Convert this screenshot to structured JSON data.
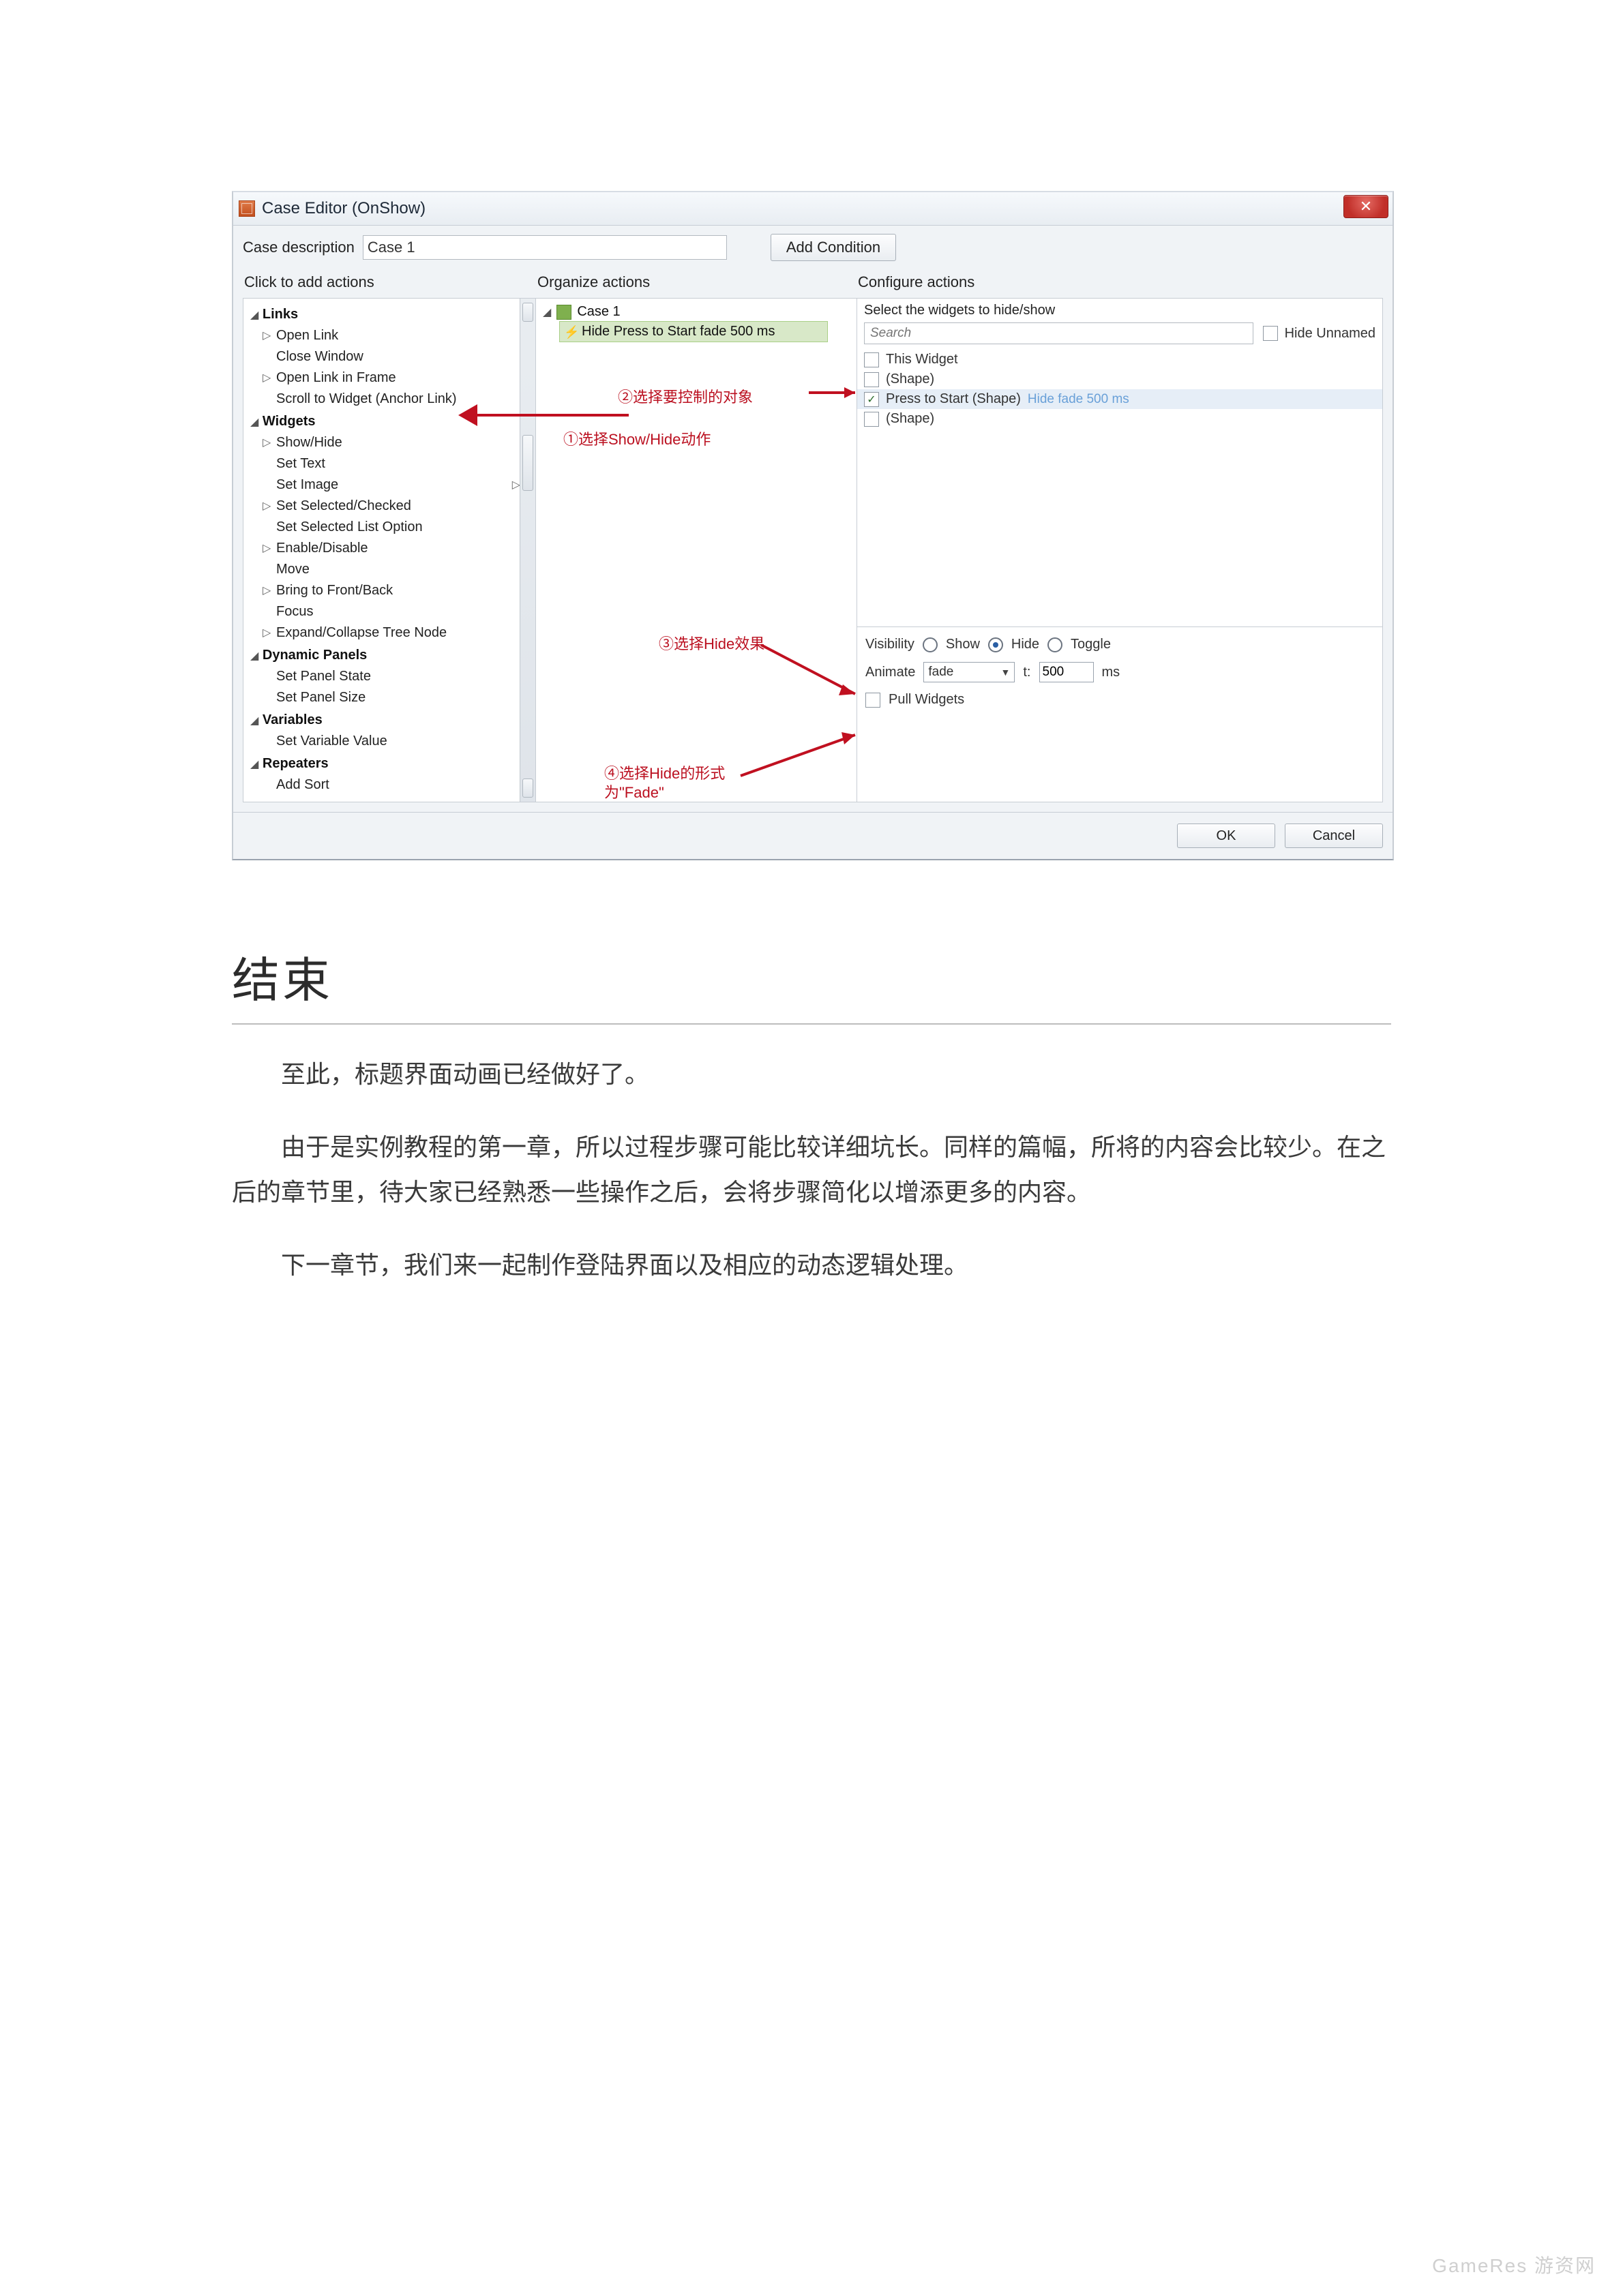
{
  "window": {
    "title": "Case Editor (OnShow)",
    "close_label": "✕"
  },
  "desc": {
    "label": "Case description",
    "value": "Case 1",
    "add_condition": "Add Condition"
  },
  "columns": {
    "c1": "Click to add actions",
    "c2": "Organize actions",
    "c3": "Configure actions"
  },
  "actions_tree": {
    "groups": [
      {
        "name": "Links",
        "items": [
          {
            "label": "Open Link",
            "expand": true
          },
          {
            "label": "Close Window"
          },
          {
            "label": "Open Link in Frame",
            "expand": true
          },
          {
            "label": "Scroll to Widget (Anchor Link)"
          }
        ]
      },
      {
        "name": "Widgets",
        "items": [
          {
            "label": "Show/Hide",
            "expand": true
          },
          {
            "label": "Set Text"
          },
          {
            "label": "Set Image",
            "expand_right": true
          },
          {
            "label": "Set Selected/Checked",
            "expand": true
          },
          {
            "label": "Set Selected List Option"
          },
          {
            "label": "Enable/Disable",
            "expand": true
          },
          {
            "label": "Move"
          },
          {
            "label": "Bring to Front/Back",
            "expand": true
          },
          {
            "label": "Focus"
          },
          {
            "label": "Expand/Collapse Tree Node",
            "expand": true
          }
        ]
      },
      {
        "name": "Dynamic Panels",
        "items": [
          {
            "label": "Set Panel State"
          },
          {
            "label": "Set Panel Size"
          }
        ]
      },
      {
        "name": "Variables",
        "items": [
          {
            "label": "Set Variable Value"
          }
        ]
      },
      {
        "name": "Repeaters",
        "items": [
          {
            "label": "Add Sort"
          }
        ]
      }
    ]
  },
  "organize": {
    "case_label": "Case 1",
    "action_label": "Hide Press to Start fade 500 ms"
  },
  "annotations": {
    "a1": "①选择Show/Hide动作",
    "a2": "②选择要控制的对象",
    "a3": "③选择Hide效果",
    "a4_line1": "④选择Hide的形式",
    "a4_line2": "为\"Fade\""
  },
  "configure": {
    "select_label": "Select the widgets to hide/show",
    "search_placeholder": "Search",
    "hide_unnamed": "Hide Unnamed",
    "widgets": [
      {
        "label": "This Widget",
        "checked": false
      },
      {
        "label": "(Shape)",
        "checked": false
      },
      {
        "label": "Press to Start (Shape)",
        "checked": true,
        "hint": "Hide fade 500 ms"
      },
      {
        "label": "(Shape)",
        "checked": false
      }
    ],
    "visibility_label": "Visibility",
    "vis_show": "Show",
    "vis_hide": "Hide",
    "vis_toggle": "Toggle",
    "animate_label": "Animate",
    "animate_value": "fade",
    "t_label": "t:",
    "t_value": "500",
    "t_unit": "ms",
    "pull_label": "Pull Widgets"
  },
  "footer": {
    "ok": "OK",
    "cancel": "Cancel"
  },
  "article": {
    "heading": "结束",
    "p1": "至此，标题界面动画已经做好了。",
    "p2": "由于是实例教程的第一章，所以过程步骤可能比较详细坑长。同样的篇幅，所将的内容会比较少。在之后的章节里，待大家已经熟悉一些操作之后，会将步骤简化以增添更多的内容。",
    "p3": "下一章节，我们来一起制作登陆界面以及相应的动态逻辑处理。"
  },
  "watermark": "GameRes 游资网"
}
